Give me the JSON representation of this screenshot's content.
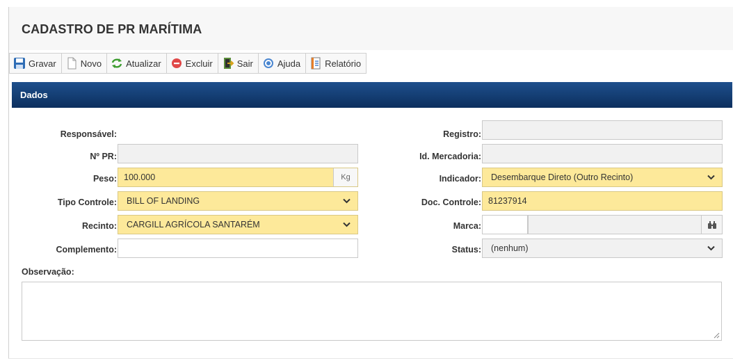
{
  "page": {
    "title": "CADASTRO DE PR MARÍTIMA"
  },
  "toolbar": {
    "buttons": [
      {
        "label": "Gravar",
        "icon": "save-icon"
      },
      {
        "label": "Novo",
        "icon": "new-document-icon"
      },
      {
        "label": "Atualizar",
        "icon": "refresh-icon"
      },
      {
        "label": "Excluir",
        "icon": "delete-icon"
      },
      {
        "label": "Sair",
        "icon": "exit-icon"
      },
      {
        "label": "Ajuda",
        "icon": "help-icon"
      },
      {
        "label": "Relatório",
        "icon": "report-icon"
      }
    ]
  },
  "section": {
    "title": "Dados"
  },
  "form": {
    "responsavel": {
      "label": "Responsável:"
    },
    "n_pr": {
      "label": "Nº PR:",
      "value": ""
    },
    "peso": {
      "label": "Peso:",
      "value": "100.000",
      "unit": "Kg"
    },
    "tipo_controle": {
      "label": "Tipo Controle:",
      "value": "BILL OF LANDING"
    },
    "recinto": {
      "label": "Recinto:",
      "value": "CARGILL AGRÍCOLA SANTARÉM"
    },
    "complemento": {
      "label": "Complemento:",
      "value": ""
    },
    "registro": {
      "label": "Registro:",
      "value": ""
    },
    "id_mercadoria": {
      "label": "Id. Mercadoria:",
      "value": ""
    },
    "indicador": {
      "label": "Indicador:",
      "value": "Desembarque Direto (Outro Recinto)"
    },
    "doc_controle": {
      "label": "Doc. Controle:",
      "value": "81237914"
    },
    "marca": {
      "label": "Marca:",
      "code": "",
      "description": ""
    },
    "status": {
      "label": "Status:",
      "value": "(nenhum)"
    },
    "observacao": {
      "label": "Observação:",
      "value": ""
    }
  },
  "colors": {
    "required_field": "#fde99a",
    "readonly_field": "#f1f1f1",
    "section_header": "#1e4f8c"
  }
}
